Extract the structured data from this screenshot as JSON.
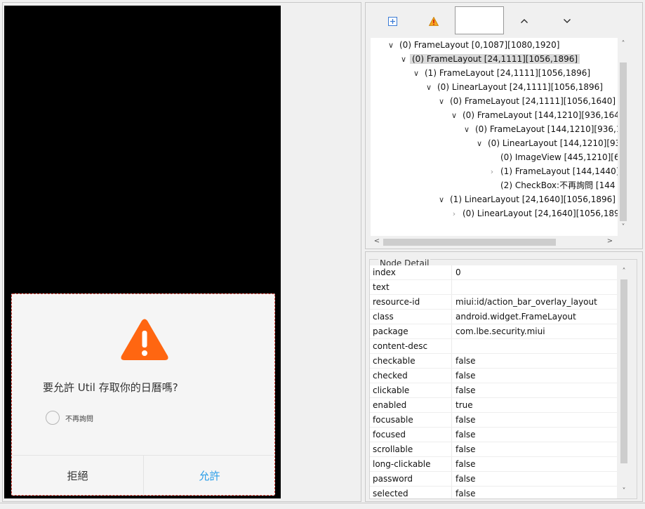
{
  "dialog": {
    "message": "要允許 Util 存取你的日曆嗎?",
    "checkbox_label": "不再詢問",
    "deny_label": "拒絕",
    "allow_label": "允許",
    "warning_color": "#ff6611",
    "allow_color": "#2a9ee9"
  },
  "toolbar": {
    "expand_icon": "expand-all-icon",
    "warning_icon": "warning-icon",
    "search_value": "",
    "up_icon": "chevron-up-icon",
    "down_icon": "chevron-down-icon"
  },
  "tree": {
    "rows": [
      {
        "label": "(0) FrameLayout [0,1087][1080,1920]",
        "expanded": true,
        "selected": false
      },
      {
        "label": "(0) FrameLayout [24,1111][1056,1896]",
        "expanded": true,
        "selected": true
      },
      {
        "label": "(1) FrameLayout [24,1111][1056,1896]",
        "expanded": true,
        "selected": false
      },
      {
        "label": "(0) LinearLayout [24,1111][1056,1896]",
        "expanded": true,
        "selected": false
      },
      {
        "label": "(0) FrameLayout [24,1111][1056,1640]",
        "expanded": true,
        "selected": false
      },
      {
        "label": "(0) FrameLayout [144,1210][936,1640",
        "expanded": true,
        "selected": false
      },
      {
        "label": "(0) FrameLayout [144,1210][936,1",
        "expanded": true,
        "selected": false
      },
      {
        "label": "(0) LinearLayout [144,1210][93",
        "expanded": true,
        "selected": false
      },
      {
        "label": "(0) ImageView [445,1210][6",
        "expanded": null,
        "selected": false
      },
      {
        "label": "(1) FrameLayout [144,1440]",
        "expanded": false,
        "selected": false
      },
      {
        "label": "(2) CheckBox:不再詢問 [144",
        "expanded": null,
        "selected": false
      },
      {
        "label": "(1) LinearLayout [24,1640][1056,1896]",
        "expanded": true,
        "selected": false
      },
      {
        "label": "(0) LinearLayout [24,1640][1056,1896",
        "expanded": false,
        "selected": false
      }
    ]
  },
  "detail": {
    "legend": "Node Detail",
    "rows": [
      {
        "key": "index",
        "value": "0"
      },
      {
        "key": "text",
        "value": ""
      },
      {
        "key": "resource-id",
        "value": "miui:id/action_bar_overlay_layout"
      },
      {
        "key": "class",
        "value": "android.widget.FrameLayout"
      },
      {
        "key": "package",
        "value": "com.lbe.security.miui"
      },
      {
        "key": "content-desc",
        "value": ""
      },
      {
        "key": "checkable",
        "value": "false"
      },
      {
        "key": "checked",
        "value": "false"
      },
      {
        "key": "clickable",
        "value": "false"
      },
      {
        "key": "enabled",
        "value": "true"
      },
      {
        "key": "focusable",
        "value": "false"
      },
      {
        "key": "focused",
        "value": "false"
      },
      {
        "key": "scrollable",
        "value": "false"
      },
      {
        "key": "long-clickable",
        "value": "false"
      },
      {
        "key": "password",
        "value": "false"
      },
      {
        "key": "selected",
        "value": "false"
      }
    ]
  }
}
